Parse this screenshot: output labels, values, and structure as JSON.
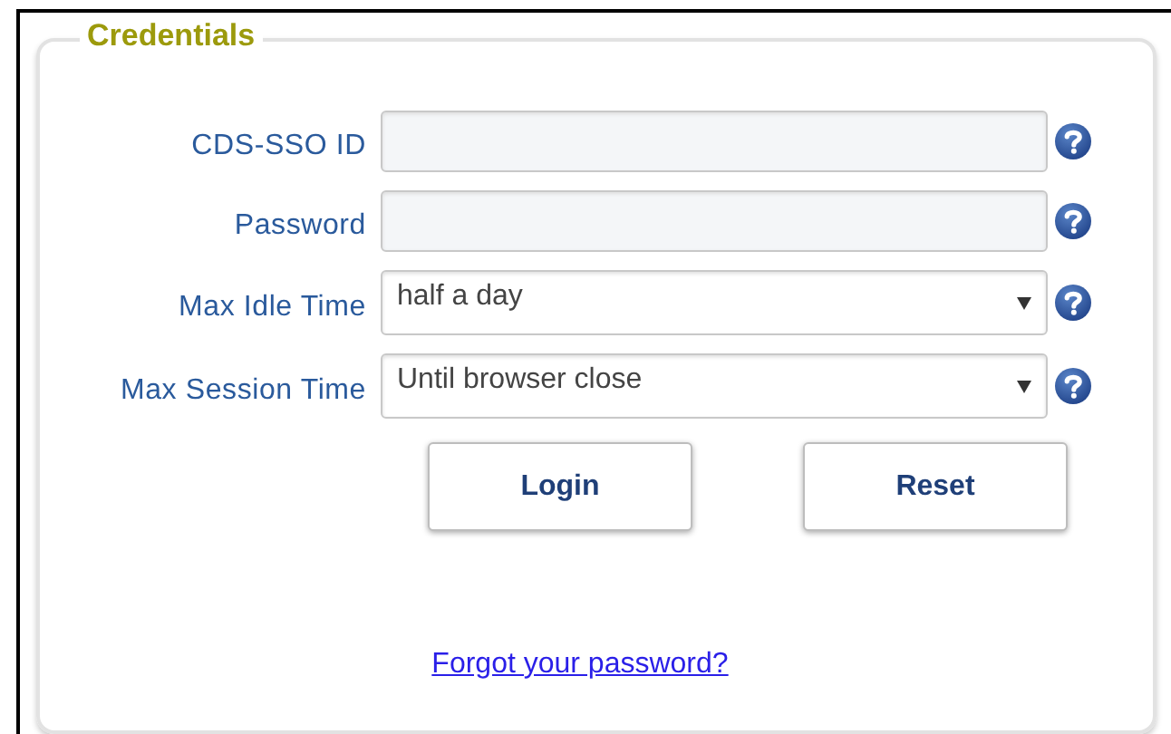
{
  "legend": "Credentials",
  "fields": [
    {
      "label": "CDS-SSO ID",
      "kind": "text"
    },
    {
      "label": "Password",
      "kind": "password"
    },
    {
      "label": "Max Idle Time",
      "kind": "select",
      "value": "half a day"
    },
    {
      "label": "Max Session Time",
      "kind": "select",
      "value": "Until browser close"
    }
  ],
  "buttons": [
    "Login",
    "Reset"
  ],
  "link": "Forgot your password?"
}
